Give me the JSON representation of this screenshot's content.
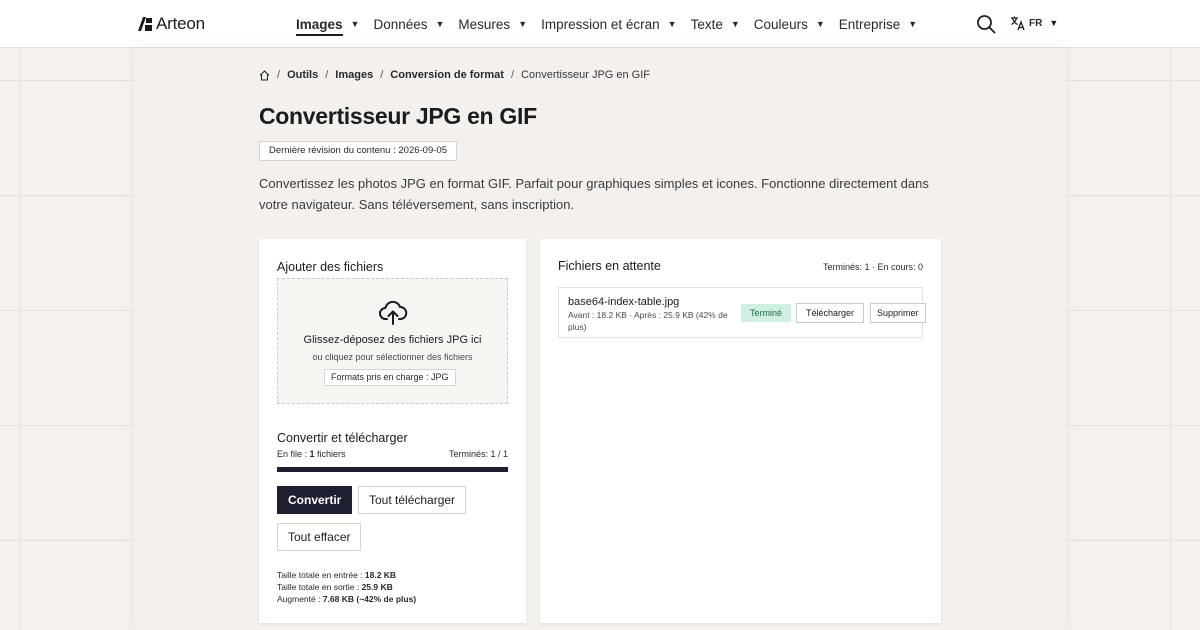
{
  "brand": {
    "name": "Arteon"
  },
  "nav": {
    "items": [
      {
        "label": "Images",
        "active": true
      },
      {
        "label": "Données",
        "active": false
      },
      {
        "label": "Mesures",
        "active": false
      },
      {
        "label": "Impression et écran",
        "active": false
      },
      {
        "label": "Texte",
        "active": false
      },
      {
        "label": "Couleurs",
        "active": false
      },
      {
        "label": "Entreprise",
        "active": false
      }
    ],
    "caret": "▼",
    "language": "FR"
  },
  "breadcrumb": {
    "items": [
      "Outils",
      "Images",
      "Conversion de format"
    ],
    "current": "Convertisseur JPG en GIF",
    "separator": "/"
  },
  "page": {
    "title": "Convertisseur JPG en GIF",
    "revision": "Dernière révision du contenu : 2026-09-05",
    "intro": "Convertissez les photos JPG en format GIF. Parfait pour graphiques simples et icones. Fonctionne directement dans votre navigateur. Sans téléversement, sans inscription."
  },
  "upload": {
    "title": "Ajouter des fichiers",
    "drop_main": "Glissez-déposez des fichiers JPG ici",
    "drop_sub": "ou cliquez pour sélectionner des fichiers",
    "formats": "Formats pris en charge : JPG"
  },
  "convert": {
    "title": "Convertir et télécharger",
    "queue_label": "En file : ",
    "queue_count": "1",
    "queue_suffix": " fichiers",
    "done_label": "Terminés: 1 / 1",
    "progress": 1.0,
    "convert_button": "Convertir",
    "download_all_button": "Tout télécharger",
    "clear_all_button": "Tout effacer",
    "stats": {
      "input_label": "Taille totale en entrée : ",
      "input_value": "18.2 KB",
      "output_label": "Taille totale en sortie : ",
      "output_value": "25.9 KB",
      "increase_label": "Augmenté : ",
      "increase_value": "7.68 KB (~42% de plus)"
    }
  },
  "queue": {
    "title": "Fichiers en attente",
    "counts": "Terminés: 1 · En cours: 0",
    "files": [
      {
        "name": "base64-index-table.jpg",
        "meta": "Avant : 18.2 KB · Après : 25.9 KB (42% de plus)",
        "status": "Terminé",
        "download_label": "Télécharger",
        "delete_label": "Supprimer"
      }
    ]
  },
  "colors": {
    "accent": "#1e1f30",
    "success_bg": "#cfefe0",
    "success_text": "#1d6b4a",
    "page_bg": "#f5f1ec"
  },
  "icons": [
    "logo-icon",
    "search-icon",
    "translate-icon",
    "home-icon",
    "cloud-upload-icon"
  ]
}
